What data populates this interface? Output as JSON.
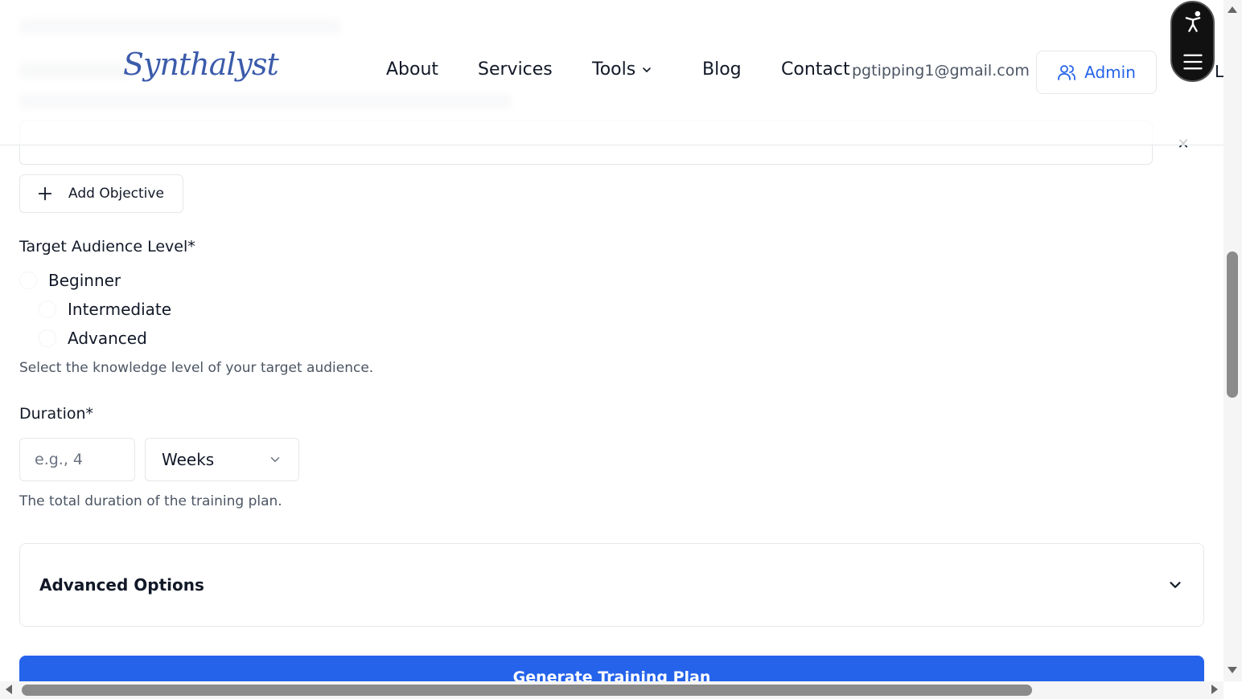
{
  "header": {
    "logo": "Synthalyst",
    "nav": {
      "about": "About",
      "services": "Services",
      "tools": "Tools",
      "blog": "Blog",
      "contact": "Contact"
    },
    "user_email": "pgtipping1@gmail.com",
    "admin_label": "Admin",
    "clipped_text": "L"
  },
  "form": {
    "add_objective_label": "Add Objective",
    "audience": {
      "label": "Target Audience Level*",
      "options": [
        "Beginner",
        "Intermediate",
        "Advanced"
      ],
      "hint": "Select the knowledge level of your target audience."
    },
    "duration": {
      "label": "Duration*",
      "placeholder": "e.g., 4",
      "unit": "Weeks",
      "hint": "The total duration of the training plan."
    },
    "advanced_options_label": "Advanced Options",
    "submit_label": "Generate Training Plan"
  },
  "icons": {
    "close": "close-icon",
    "plus": "plus-icon",
    "chevron": "chevron-down-icon",
    "users": "users-icon",
    "accessibility": "accessibility-icon",
    "menu": "menu-icon"
  },
  "colors": {
    "primary": "#2563eb",
    "logo": "#3b5bab",
    "text": "#111827",
    "muted": "#4b5563",
    "border": "#e5e7eb"
  }
}
